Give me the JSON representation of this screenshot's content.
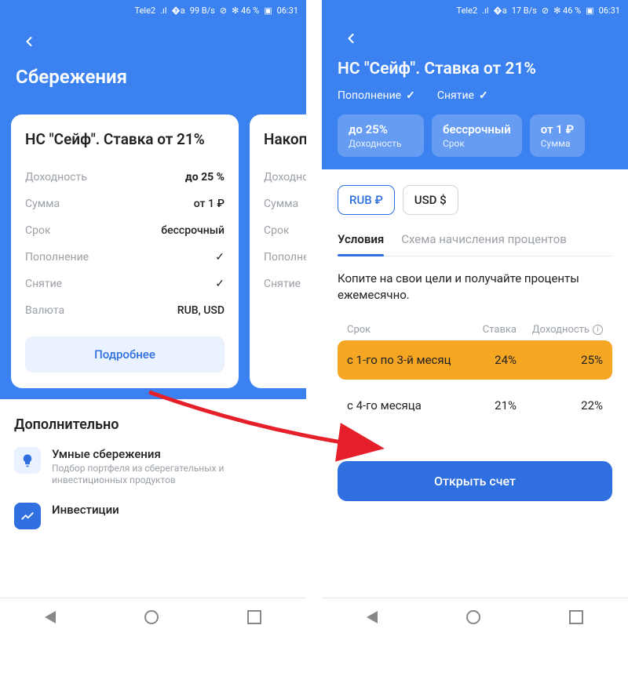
{
  "status": {
    "carrier": "Tele2",
    "signal": "📶",
    "wifi": "📶",
    "speed_left": "99 B/s",
    "speed_right": "17 B/s",
    "shield": "✓",
    "bt_battery": "✻ 46 %",
    "batt": "🔋",
    "time": "06:31"
  },
  "left": {
    "page_title": "Сбережения",
    "card1": {
      "title": "НС \"Сейф\". Ставка от 21%",
      "row_yield_label": "Доходность",
      "row_yield_value": "до 25 %",
      "row_sum_label": "Сумма",
      "row_sum_value": "от 1 ₽",
      "row_term_label": "Срок",
      "row_term_value": "бессрочный",
      "row_topup_label": "Пополнение",
      "row_withdraw_label": "Снятие",
      "row_currency_label": "Валюта",
      "row_currency_value": "RUB, USD",
      "detail_btn": "Подробнее"
    },
    "card2": {
      "title": "Накопительный счет",
      "row_yield_label": "Доходность",
      "row_sum_label": "Сумма",
      "row_term_label": "Срок",
      "row_topup_label": "Пополнение",
      "row_withdraw_label": "Снятие"
    },
    "additional": {
      "title": "Дополнительно",
      "item1_title": "Умные сбережения",
      "item1_sub": "Подбор портфеля из сберегательных и инвестиционных продуктов",
      "item2_title": "Инвестиции"
    }
  },
  "right": {
    "title": "НС \"Сейф\". Ставка от 21%",
    "feat1": "Пополнение",
    "feat2": "Снятие",
    "pill1_top": "до 25%",
    "pill1_bot": "Доходность",
    "pill2_top": "бессрочный",
    "pill2_bot": "Срок",
    "pill3_top": "от 1 ₽",
    "pill3_bot": "Сумма",
    "cur_rub": "RUB ₽",
    "cur_usd": "USD $",
    "tab1": "Условия",
    "tab2": "Схема начисления процентов",
    "desc": "Копите на свои цели и получайте проценты ежемесячно.",
    "th_term": "Срок",
    "th_rate": "Ставка",
    "th_yield": "Доходность",
    "row1_term": "с 1-го по 3-й месяц",
    "row1_rate": "24%",
    "row1_yield": "25%",
    "row2_term": "с 4-го месяца",
    "row2_rate": "21%",
    "row2_yield": "22%",
    "open_btn": "Открыть счет"
  }
}
